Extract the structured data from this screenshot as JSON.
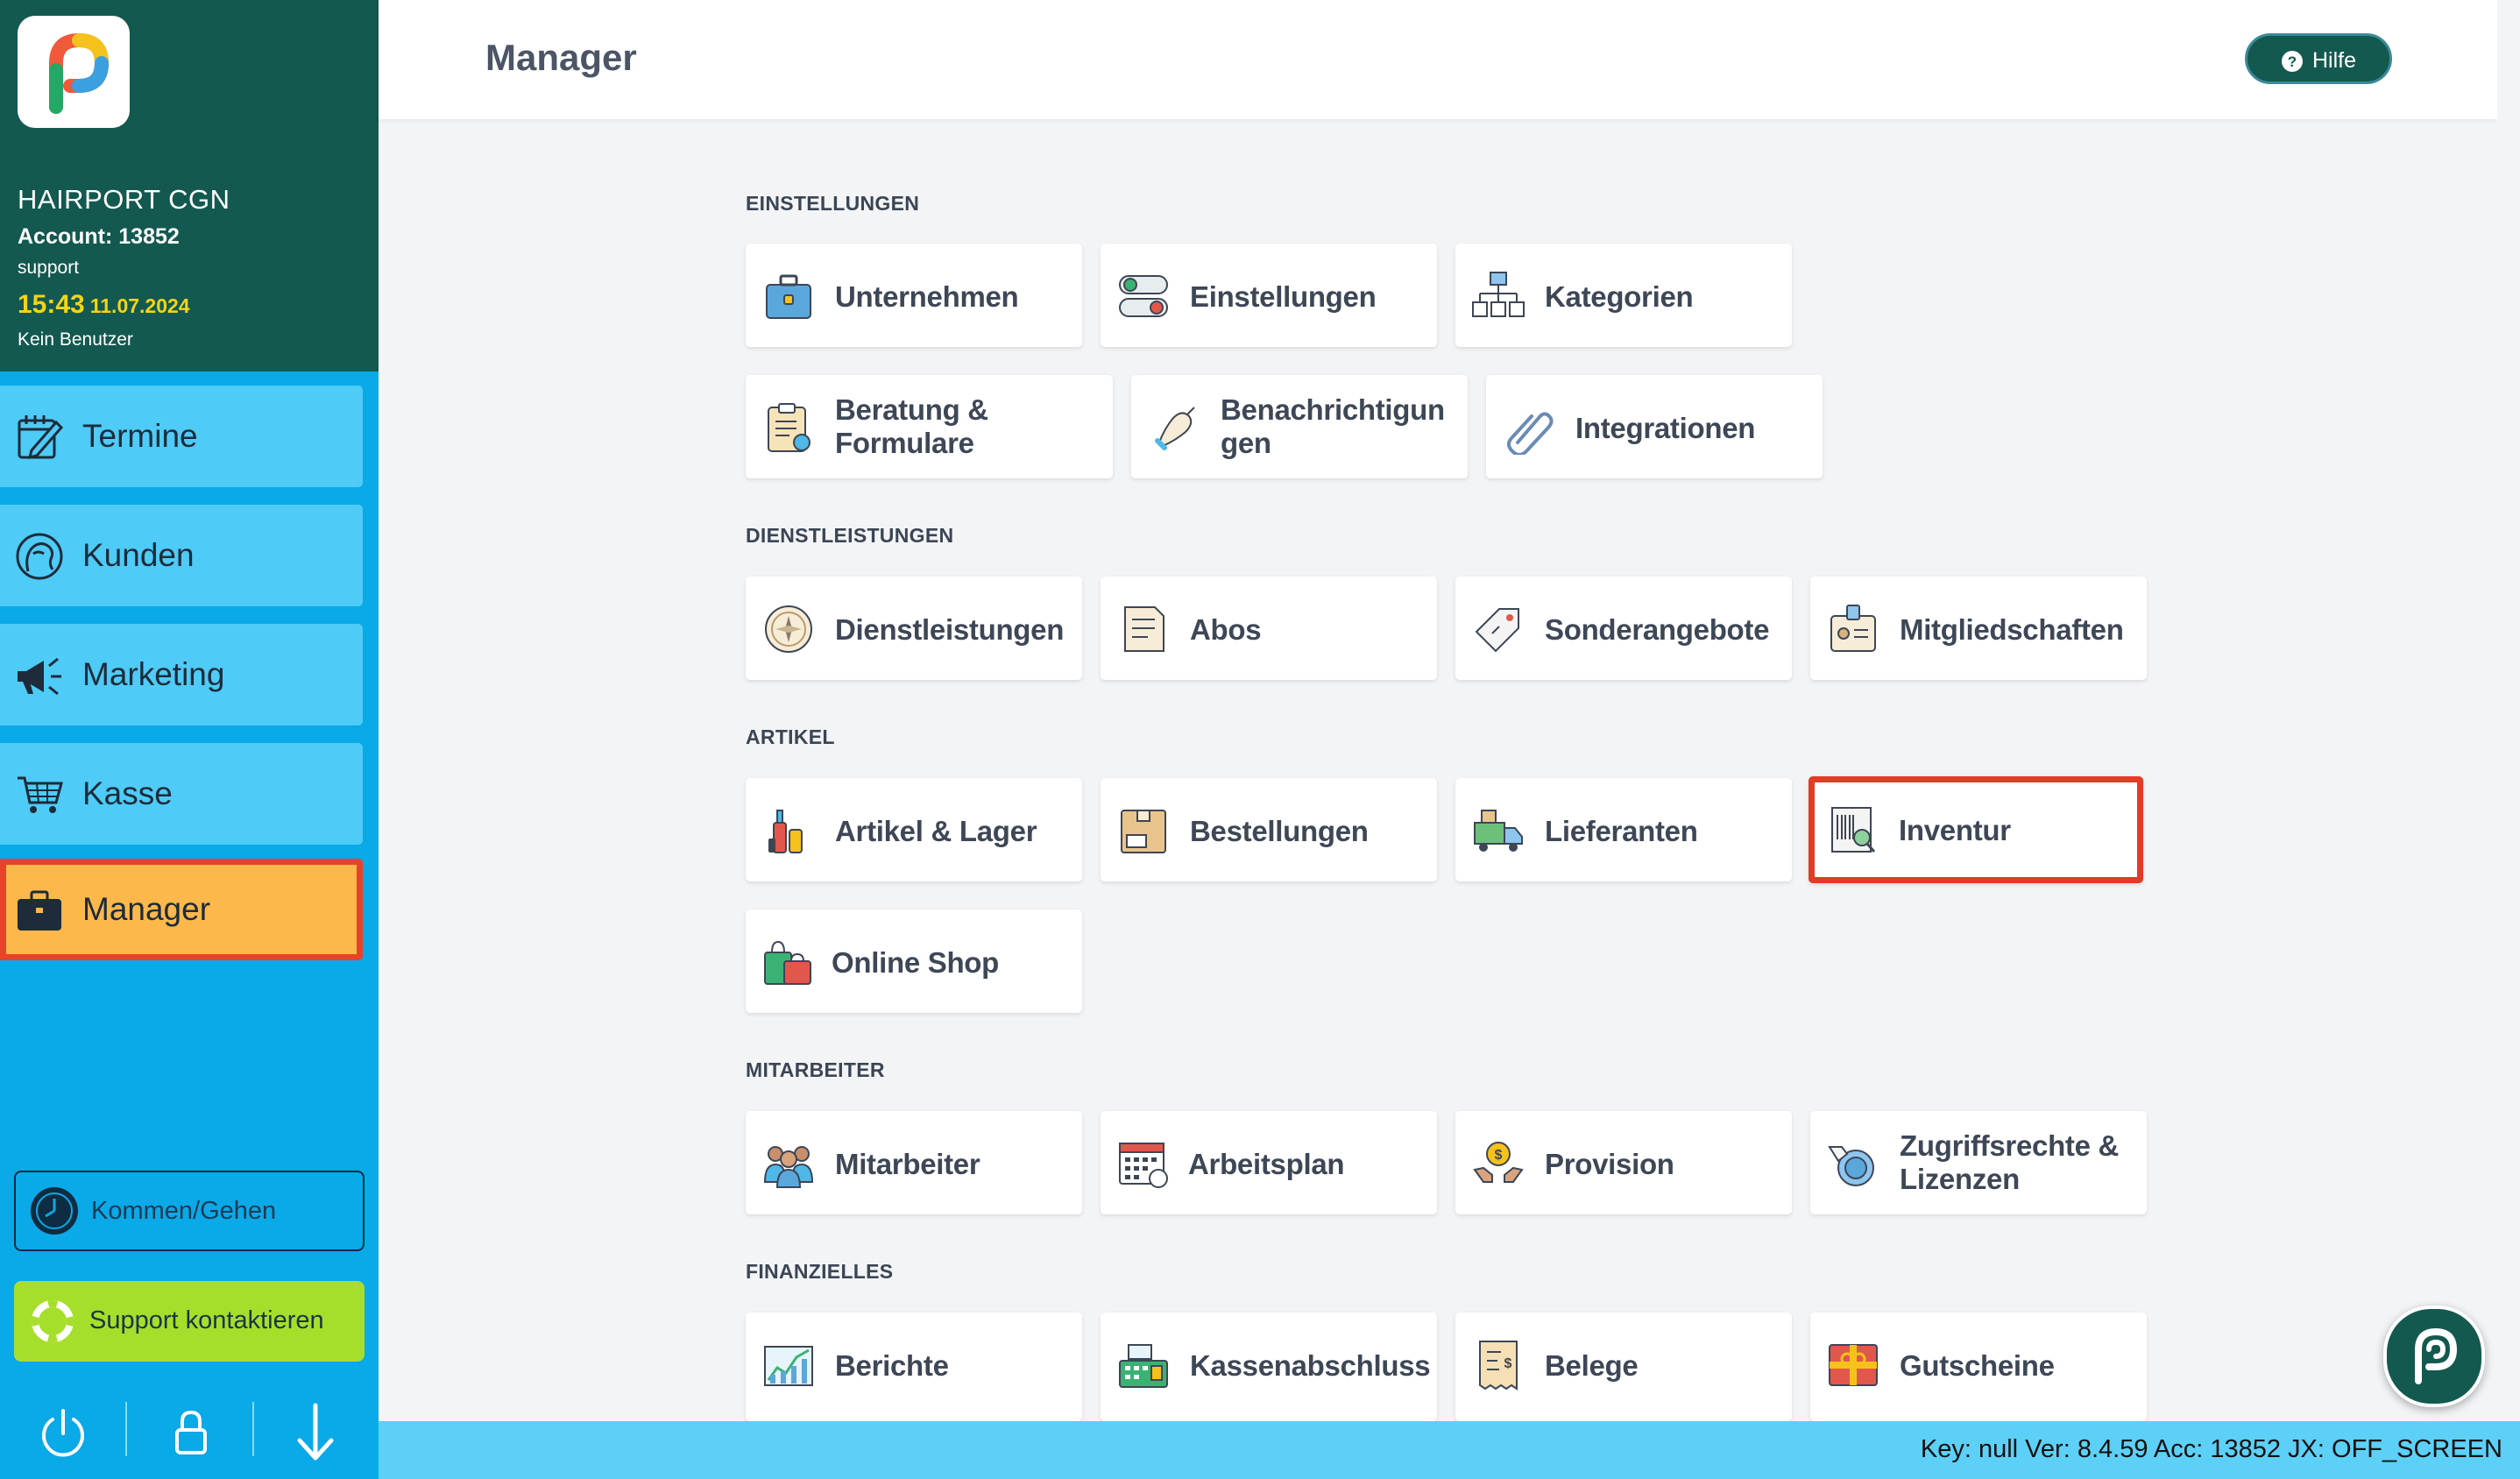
{
  "sidebar": {
    "company": "HAIRPORT CGN",
    "account": "Account: 13852",
    "user": "support",
    "time": "15:43",
    "date": "11.07.2024",
    "no_user": "Kein Benutzer",
    "nav": [
      {
        "label": "Termine",
        "icon": "calendar-edit-icon"
      },
      {
        "label": "Kunden",
        "icon": "customer-head-icon"
      },
      {
        "label": "Marketing",
        "icon": "megaphone-icon"
      },
      {
        "label": "Kasse",
        "icon": "shopping-cart-icon"
      },
      {
        "label": "Manager",
        "icon": "briefcase-icon",
        "active": true
      }
    ],
    "clock_in_label": "Kommen/Gehen",
    "support_label": "Support kontaktieren",
    "bottom_icons": [
      "power-icon",
      "lock-icon",
      "arrow-down-icon"
    ]
  },
  "header": {
    "title": "Manager",
    "help_label": "Hilfe"
  },
  "sections": {
    "einstellungen": {
      "title": "EINSTELLUNGEN",
      "tiles": [
        "Unternehmen",
        "Einstellungen",
        "Kategorien",
        "Beratung & Formulare",
        "Benachrichtigungen",
        "Integrationen"
      ]
    },
    "dienstleistungen": {
      "title": "DIENSTLEISTUNGEN",
      "tiles": [
        "Dienstleistungen",
        "Abos",
        "Sonderangebote",
        "Mitgliedschaften"
      ]
    },
    "artikel": {
      "title": "ARTIKEL",
      "tiles": [
        "Artikel & Lager",
        "Bestellungen",
        "Lieferanten",
        "Inventur",
        "Online Shop"
      ],
      "highlighted": "Inventur"
    },
    "mitarbeiter": {
      "title": "MITARBEITER",
      "tiles": [
        "Mitarbeiter",
        "Arbeitsplan",
        "Provision",
        "Zugriffsrechte & Lizenzen"
      ]
    },
    "finanzielles": {
      "title": "FINANZIELLES",
      "tiles": [
        "Berichte",
        "Kassenabschluss",
        "Belege",
        "Gutscheine"
      ]
    }
  },
  "status_bar": "Key: null Ver: 8.4.59 Acc: 13852  JX: OFF_SCREEN",
  "colors": {
    "sidebar_header": "#13594f",
    "sidebar_bg": "#0aa9e8",
    "nav_item": "#4ecbf6",
    "nav_active": "#fdb84b",
    "highlight_border": "#e33b26",
    "clock": "#f3d417",
    "support_button": "#a6df2b",
    "status_bar": "#5dd0f7"
  }
}
